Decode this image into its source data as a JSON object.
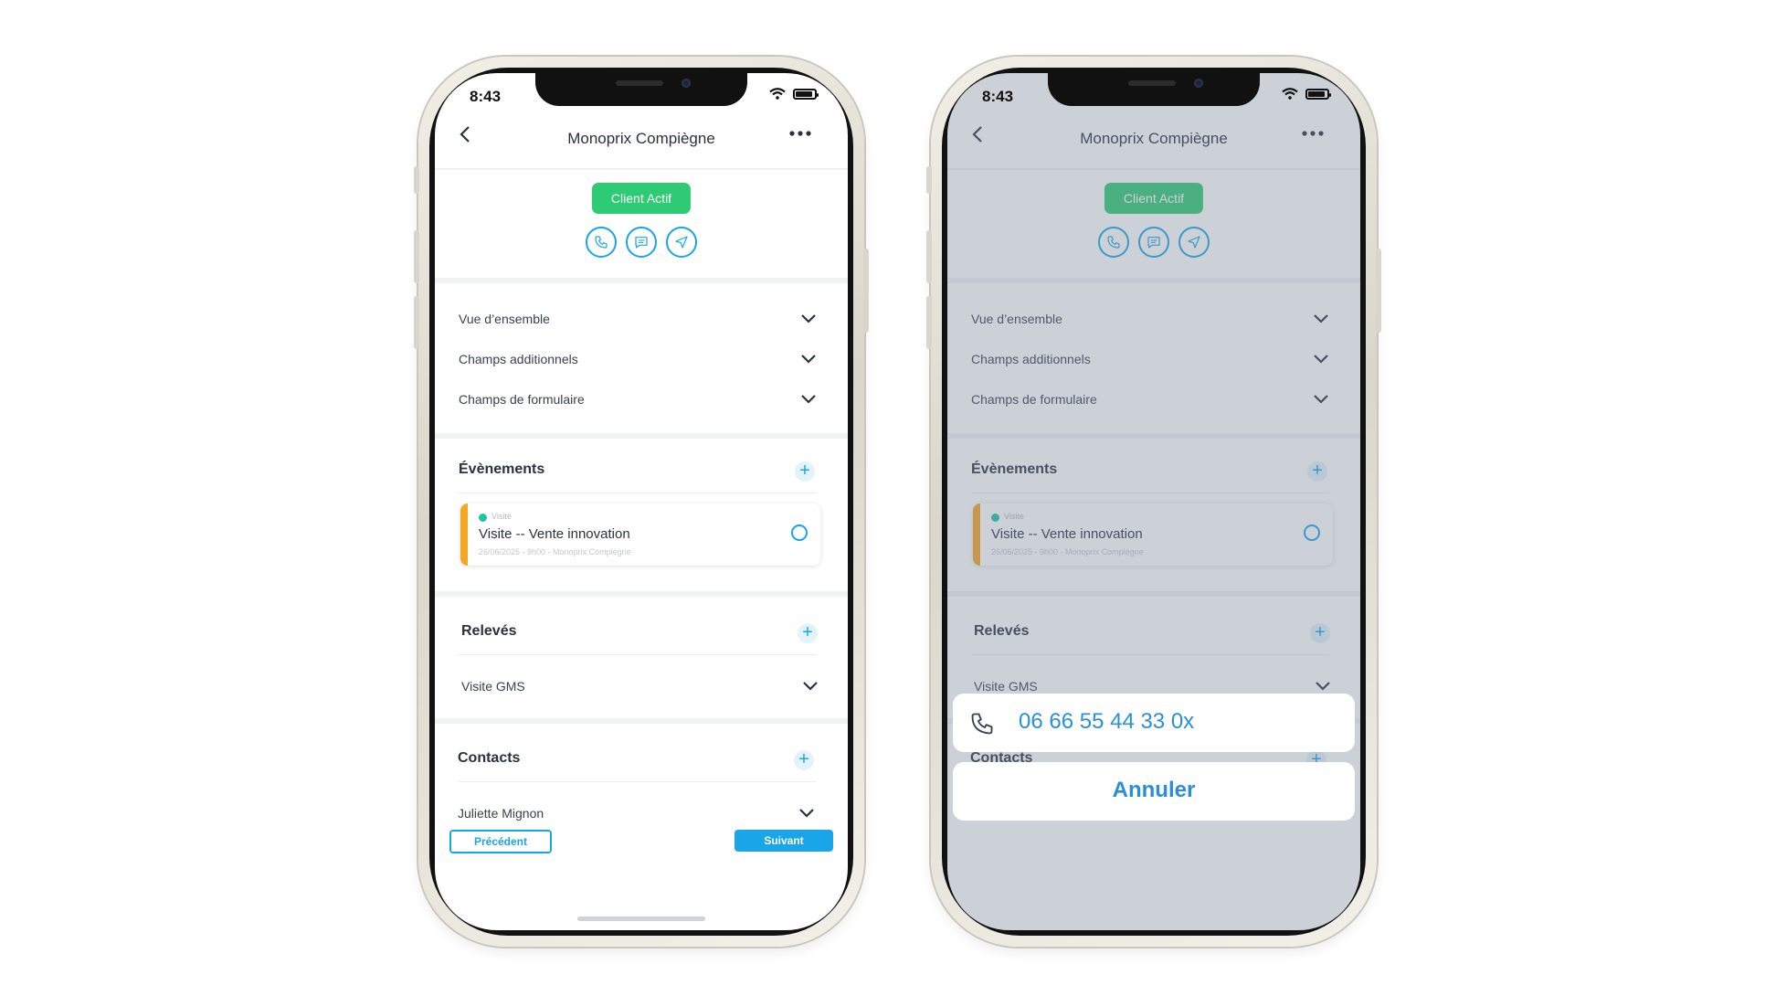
{
  "colors": {
    "accent": "#1aa5e8",
    "active_badge": "#2ecb74",
    "event_bar": "#f5a623",
    "event_dot": "#20c2a6",
    "overlay": "rgba(120,132,150,0.38)"
  },
  "status_bar": {
    "time": "8:43"
  },
  "header": {
    "title": "Monoprix Compiègne",
    "back_icon": "chevron-left-icon",
    "more_icon": "more-horizontal-icon"
  },
  "client_badge": "Client Actif",
  "quick_actions": [
    {
      "icon": "phone-icon"
    },
    {
      "icon": "message-icon"
    },
    {
      "icon": "navigation-icon"
    }
  ],
  "accordion": [
    {
      "label": "Vue d’ensemble"
    },
    {
      "label": "Champs additionnels"
    },
    {
      "label": "Champs de formulaire"
    }
  ],
  "events": {
    "title": "Évènements",
    "items": [
      {
        "type": "Visite",
        "title": "Visite  -- Vente innovation",
        "meta": "26/06/2025 - 9h00 - Monoprix Compiègne"
      }
    ]
  },
  "releves": {
    "title": "Relevés",
    "item": "Visite GMS"
  },
  "contacts": {
    "title": "Contacts",
    "item": "Juliette Mignon"
  },
  "nav": {
    "prev": "Précédent",
    "next": "Suivant"
  },
  "action_sheet": {
    "phone_number": "06 66 55 44 33 0x",
    "cancel": "Annuler"
  }
}
